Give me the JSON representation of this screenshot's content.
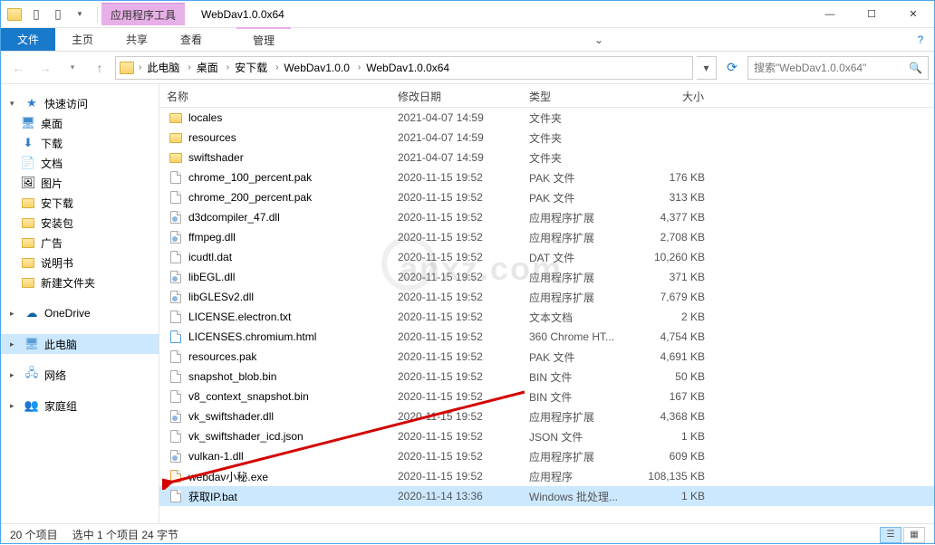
{
  "titlebar": {
    "context_tab": "应用程序工具",
    "title": "WebDav1.0.0x64"
  },
  "ribbon": {
    "file": "文件",
    "tabs": [
      "主页",
      "共享",
      "查看"
    ],
    "context_tab": "管理"
  },
  "address": {
    "segments": [
      "此电脑",
      "桌面",
      "安下载",
      "WebDav1.0.0",
      "WebDav1.0.0x64"
    ],
    "search_placeholder": "搜索\"WebDav1.0.0x64\""
  },
  "nav": {
    "quick": {
      "label": "快速访问",
      "items": [
        "桌面",
        "下载",
        "文档",
        "图片",
        "安下载",
        "安装包",
        "广告",
        "说明书",
        "新建文件夹"
      ]
    },
    "onedrive": "OneDrive",
    "thispc": "此电脑",
    "network": "网络",
    "homegroup": "家庭组"
  },
  "columns": {
    "name": "名称",
    "date": "修改日期",
    "type": "类型",
    "size": "大小"
  },
  "files": [
    {
      "icon": "folder",
      "name": "locales",
      "date": "2021-04-07 14:59",
      "type": "文件夹",
      "size": ""
    },
    {
      "icon": "folder",
      "name": "resources",
      "date": "2021-04-07 14:59",
      "type": "文件夹",
      "size": ""
    },
    {
      "icon": "folder",
      "name": "swiftshader",
      "date": "2021-04-07 14:59",
      "type": "文件夹",
      "size": ""
    },
    {
      "icon": "file",
      "name": "chrome_100_percent.pak",
      "date": "2020-11-15 19:52",
      "type": "PAK 文件",
      "size": "176 KB"
    },
    {
      "icon": "file",
      "name": "chrome_200_percent.pak",
      "date": "2020-11-15 19:52",
      "type": "PAK 文件",
      "size": "313 KB"
    },
    {
      "icon": "dll",
      "name": "d3dcompiler_47.dll",
      "date": "2020-11-15 19:52",
      "type": "应用程序扩展",
      "size": "4,377 KB"
    },
    {
      "icon": "dll",
      "name": "ffmpeg.dll",
      "date": "2020-11-15 19:52",
      "type": "应用程序扩展",
      "size": "2,708 KB"
    },
    {
      "icon": "file",
      "name": "icudtl.dat",
      "date": "2020-11-15 19:52",
      "type": "DAT 文件",
      "size": "10,260 KB"
    },
    {
      "icon": "dll",
      "name": "libEGL.dll",
      "date": "2020-11-15 19:52",
      "type": "应用程序扩展",
      "size": "371 KB"
    },
    {
      "icon": "dll",
      "name": "libGLESv2.dll",
      "date": "2020-11-15 19:52",
      "type": "应用程序扩展",
      "size": "7,679 KB"
    },
    {
      "icon": "file",
      "name": "LICENSE.electron.txt",
      "date": "2020-11-15 19:52",
      "type": "文本文档",
      "size": "2 KB"
    },
    {
      "icon": "html",
      "name": "LICENSES.chromium.html",
      "date": "2020-11-15 19:52",
      "type": "360 Chrome HT...",
      "size": "4,754 KB"
    },
    {
      "icon": "file",
      "name": "resources.pak",
      "date": "2020-11-15 19:52",
      "type": "PAK 文件",
      "size": "4,691 KB"
    },
    {
      "icon": "file",
      "name": "snapshot_blob.bin",
      "date": "2020-11-15 19:52",
      "type": "BIN 文件",
      "size": "50 KB"
    },
    {
      "icon": "file",
      "name": "v8_context_snapshot.bin",
      "date": "2020-11-15 19:52",
      "type": "BIN 文件",
      "size": "167 KB"
    },
    {
      "icon": "dll",
      "name": "vk_swiftshader.dll",
      "date": "2020-11-15 19:52",
      "type": "应用程序扩展",
      "size": "4,368 KB"
    },
    {
      "icon": "file",
      "name": "vk_swiftshader_icd.json",
      "date": "2020-11-15 19:52",
      "type": "JSON 文件",
      "size": "1 KB"
    },
    {
      "icon": "dll",
      "name": "vulkan-1.dll",
      "date": "2020-11-15 19:52",
      "type": "应用程序扩展",
      "size": "609 KB"
    },
    {
      "icon": "exe",
      "name": "webdav小秘.exe",
      "date": "2020-11-15 19:52",
      "type": "应用程序",
      "size": "108,135 KB"
    },
    {
      "icon": "file",
      "name": "获取IP.bat",
      "date": "2020-11-14 13:36",
      "type": "Windows 批处理...",
      "size": "1 KB",
      "selected": true
    }
  ],
  "status": {
    "count": "20 个项目",
    "selection": "选中 1 个项目 24 字节"
  },
  "watermark": "anxz.com"
}
